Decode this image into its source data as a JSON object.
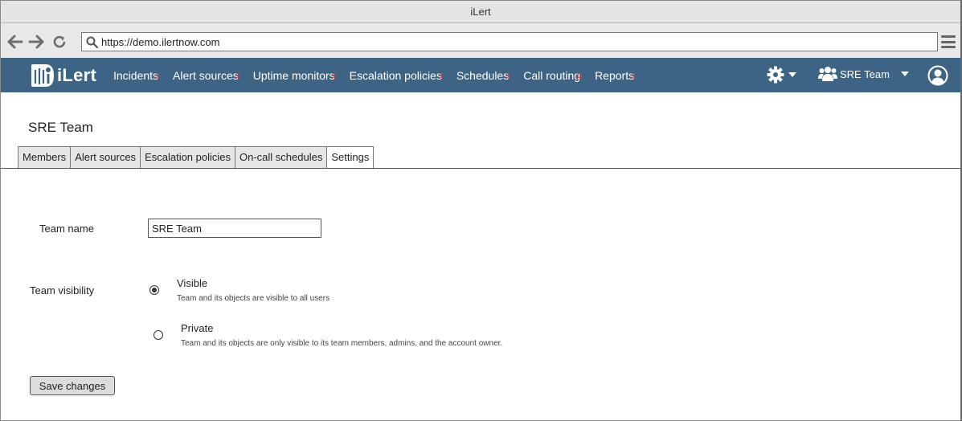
{
  "window": {
    "title": "iLert"
  },
  "browser": {
    "url": "https://demo.ilertnow.com"
  },
  "navbar": {
    "logo_text": "iLert",
    "menu": [
      {
        "label": "Incidents"
      },
      {
        "label": "Alert sources"
      },
      {
        "label": "Uptime monitors"
      },
      {
        "label": "Escalation policies"
      },
      {
        "label": "Schedules"
      },
      {
        "label": "Call routing"
      },
      {
        "label": "Reports"
      }
    ],
    "team_label": "SRE Team",
    "brand_color": "#3d6484"
  },
  "page": {
    "title": "SRE Team",
    "tabs": [
      {
        "label": "Members",
        "active": false
      },
      {
        "label": "Alert sources",
        "active": false
      },
      {
        "label": "Escalation policies",
        "active": false
      },
      {
        "label": "On-call schedules",
        "active": false
      },
      {
        "label": "Settings",
        "active": true
      }
    ]
  },
  "form": {
    "team_name_label": "Team name",
    "team_name_value": "SRE Team",
    "visibility_label": "Team visibility",
    "options": [
      {
        "title": "Visible",
        "description": "Team and its objects are visible to all users",
        "checked": true
      },
      {
        "title": "Private",
        "description": "Team and its objects are only visible to its team members, admins, and the account owner.",
        "checked": false
      }
    ],
    "save_label": "Save changes"
  }
}
